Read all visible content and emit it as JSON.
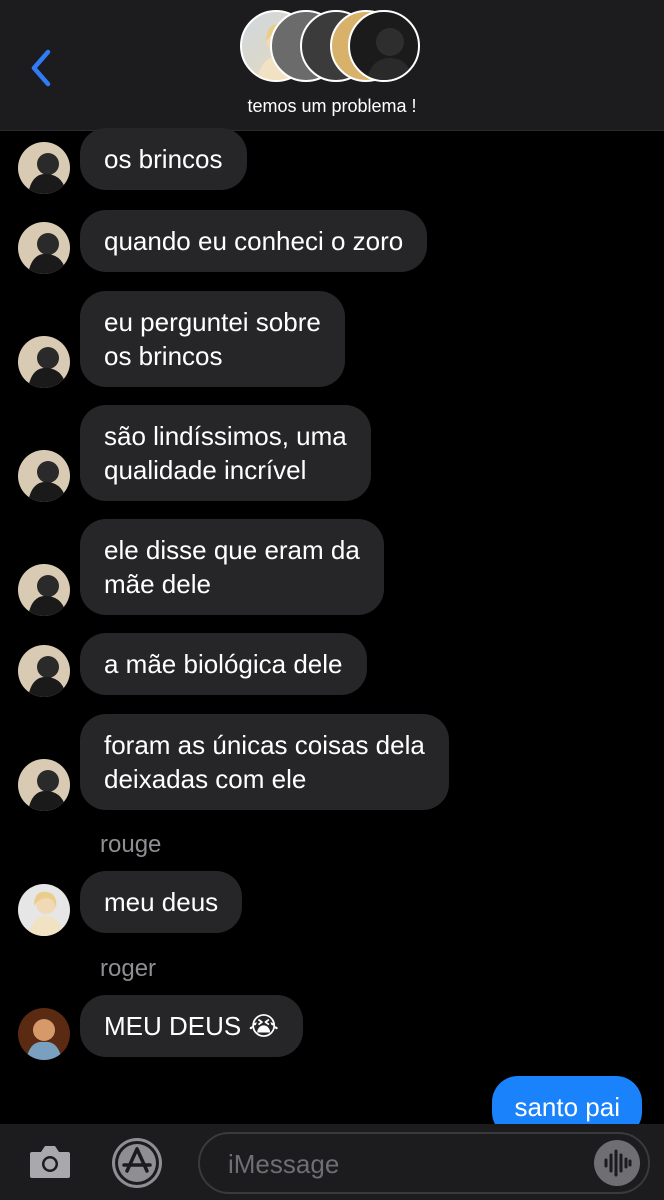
{
  "header": {
    "back_icon": "chevron-left-icon",
    "group_title": "temos um problema !",
    "accent_color": "#2f7cf6"
  },
  "messages": [
    {
      "lines": [
        "os brincos"
      ]
    },
    {
      "lines": [
        "quando eu conheci o zoro"
      ]
    },
    {
      "lines": [
        "eu perguntei sobre",
        "os brincos"
      ]
    },
    {
      "lines": [
        "são lindíssimos, uma",
        "qualidade incrível"
      ]
    },
    {
      "lines": [
        "ele disse que eram da",
        "mãe dele"
      ]
    },
    {
      "lines": [
        "a mãe biológica dele"
      ]
    },
    {
      "lines": [
        "foram as únicas coisas dela",
        "deixadas com ele"
      ]
    },
    {
      "sender": "rouge",
      "lines": [
        "meu deus"
      ]
    },
    {
      "sender": "roger",
      "lines": [
        "MEU DEUS 😭"
      ]
    }
  ],
  "sent_message": "santo pai",
  "bottom_bar": {
    "camera_icon": "camera-icon",
    "appstore_icon": "app-store-icon",
    "input_placeholder": "iMessage",
    "audio_icon": "audio-waveform-icon",
    "sent_color": "#1a82fb"
  }
}
